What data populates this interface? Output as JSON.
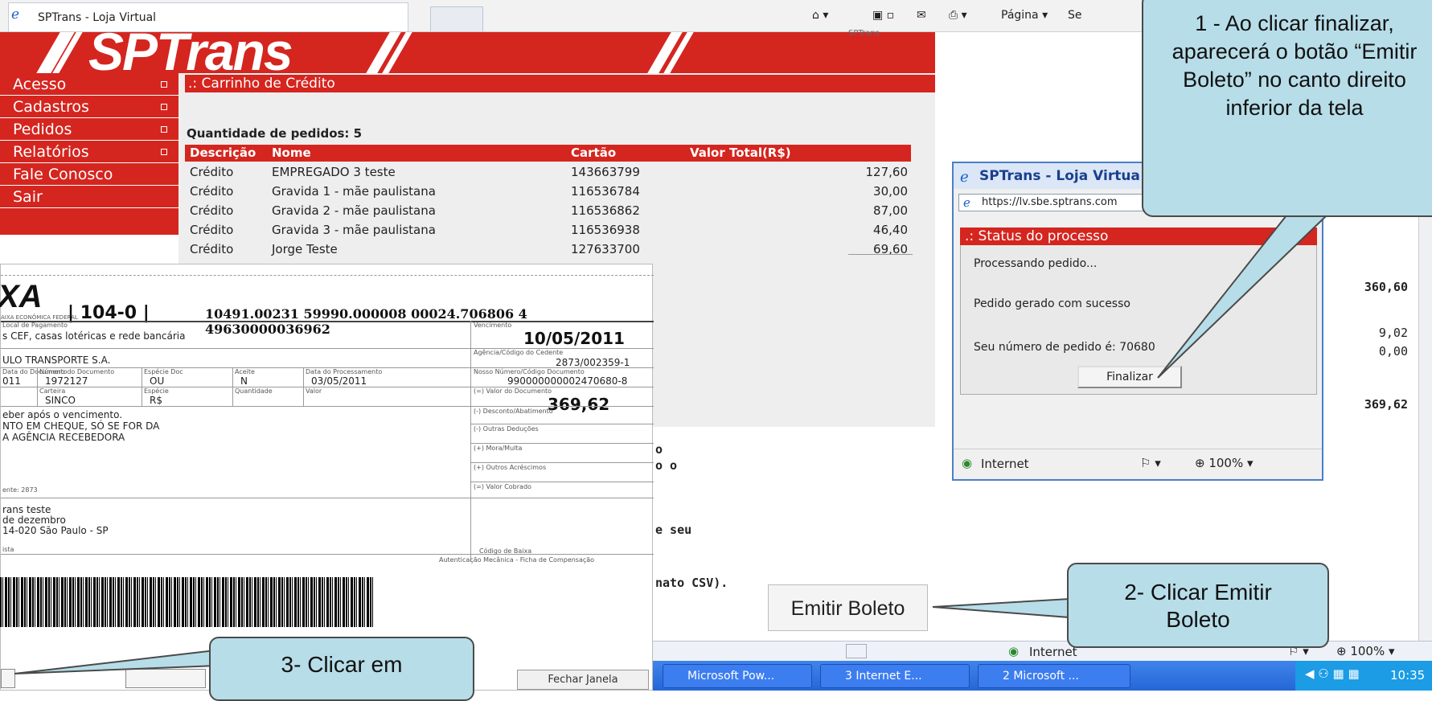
{
  "browser": {
    "tab_title": "SPTrans - Loja Virtual",
    "toolbar_page": "Página",
    "toolbar_se": "Se"
  },
  "site": {
    "logo": "SPTrans",
    "top_right_label": "SPTrans"
  },
  "sidebar": {
    "items": [
      {
        "label": "Acesso"
      },
      {
        "label": "Cadastros"
      },
      {
        "label": "Pedidos"
      },
      {
        "label": "Relatórios"
      },
      {
        "label": "Fale Conosco"
      },
      {
        "label": "Sair"
      }
    ]
  },
  "main": {
    "section_title": ".: Carrinho de Crédito",
    "quantity_label": "Quantidade de pedidos: 5",
    "columns": [
      "Descrição",
      "Nome",
      "Cartão",
      "Valor Total(R$)"
    ],
    "rows": [
      {
        "desc": "Crédito",
        "name": "EMPREGADO 3 teste",
        "card": "143663799",
        "value": "127,60"
      },
      {
        "desc": "Crédito",
        "name": "Gravida 1 - mãe paulistana",
        "card": "116536784",
        "value": "30,00"
      },
      {
        "desc": "Crédito",
        "name": "Gravida 2 - mãe paulistana",
        "card": "116536862",
        "value": "87,00"
      },
      {
        "desc": "Crédito",
        "name": "Gravida 3 - mãe paulistana",
        "card": "116536938",
        "value": "46,40"
      },
      {
        "desc": "Crédito",
        "name": "Jorge Teste",
        "card": "127633700",
        "value": "69,60"
      }
    ],
    "subtotal": "360,60",
    "fee1": "9,02",
    "fee2": "0,00",
    "total": "369,62",
    "text_o": "o",
    "text_oo": "o o",
    "text_seu": "e seu",
    "text_csv": "nato CSV)."
  },
  "boleto": {
    "bank_logo": "XA",
    "bank_sub": "AIXA ECONÔMICA FEDERAL",
    "bank_code": "104-0",
    "line": "10491.00231 59990.000008 00024.706806 4 49630000036962",
    "pagamento_label": "Local de Pagamento",
    "pagamento": "s CEF, casas lotéricas e rede bancária",
    "vencimento_label": "Vencimento",
    "vencimento": "10/05/2011",
    "cedente": "ULO TRANSPORTE S.A.",
    "agencia_label": "Agência/Código do Cedente",
    "agencia": "2873/002359-1",
    "data_label": "Data do Documento",
    "data_doc": "011",
    "num_doc_label": "Número do Documento",
    "num_doc": "1972127",
    "especie_doc_label": "Espécie Doc",
    "especie_doc": "OU",
    "aceite_label": "Aceite",
    "aceite": "N",
    "data_proc_label": "Data do Processamento",
    "data_proc": "03/05/2011",
    "nosso_label": "Nosso Número/Código Documento",
    "nosso": "990000000002470680-8",
    "carteira_label": "Carteira",
    "carteira": "SINCO",
    "especie_label": "Espécie",
    "especie": "R$",
    "quantidade_label": "Quantidade",
    "valor_label": "Valor",
    "valor_doc_label": "(=) Valor do Documento",
    "valor_doc": "369,62",
    "instr1": "eber após o vencimento.",
    "instr2": "NTO EM CHEQUE, SÓ SE FOR DA",
    "instr3": "A AGÊNCIA RECEBEDORA",
    "desconto_label": "(-) Desconto/Abatimento",
    "outras_ded_label": "(-) Outras Deduções",
    "mora_label": "(+) Mora/Multa",
    "outros_acr_label": "(+) Outros Acréscimos",
    "cobrado_label": "(=) Valor Cobrado",
    "cedente_small": "ente: 2873",
    "sacado1": "rans teste",
    "sacado2": "de dezembro",
    "sacado3": "14-020 São Paulo - SP",
    "sacado_label": "ista",
    "codigo_baixa": "Código de Baixa",
    "autenticacao": "Autenticação Mecânica - Ficha de Compensação",
    "fechar": "Fechar Janela"
  },
  "popup": {
    "title": "SPTrans - Loja Virtua",
    "address": "https://lv.sbe.sptrans.com",
    "status_title": ".: Status do processo",
    "line1": "Processando pedido...",
    "line2": "Pedido gerado com sucesso",
    "line3": "Seu número de pedido é: 70680",
    "finalizar": "Finalizar",
    "zone": "Internet",
    "zoom": "100%"
  },
  "emitir_button": "Emitir Boleto",
  "statusbar": {
    "zone": "Internet",
    "zoom": "100%"
  },
  "taskbar": {
    "items": [
      {
        "label": "Microsoft Pow..."
      },
      {
        "label": "3 Internet E..."
      },
      {
        "label": "2 Microsoft ..."
      }
    ],
    "clock": "10:35"
  },
  "callouts": {
    "c1": "1 - Ao clicar finalizar, aparecerá o botão “Emitir Boleto” no canto direito inferior da tela",
    "c2": "2- Clicar Emitir Boleto",
    "c3": "3- Clicar em"
  },
  "colors": {
    "brand_red": "#d5251f",
    "callout_fill": "#b7dde8"
  }
}
